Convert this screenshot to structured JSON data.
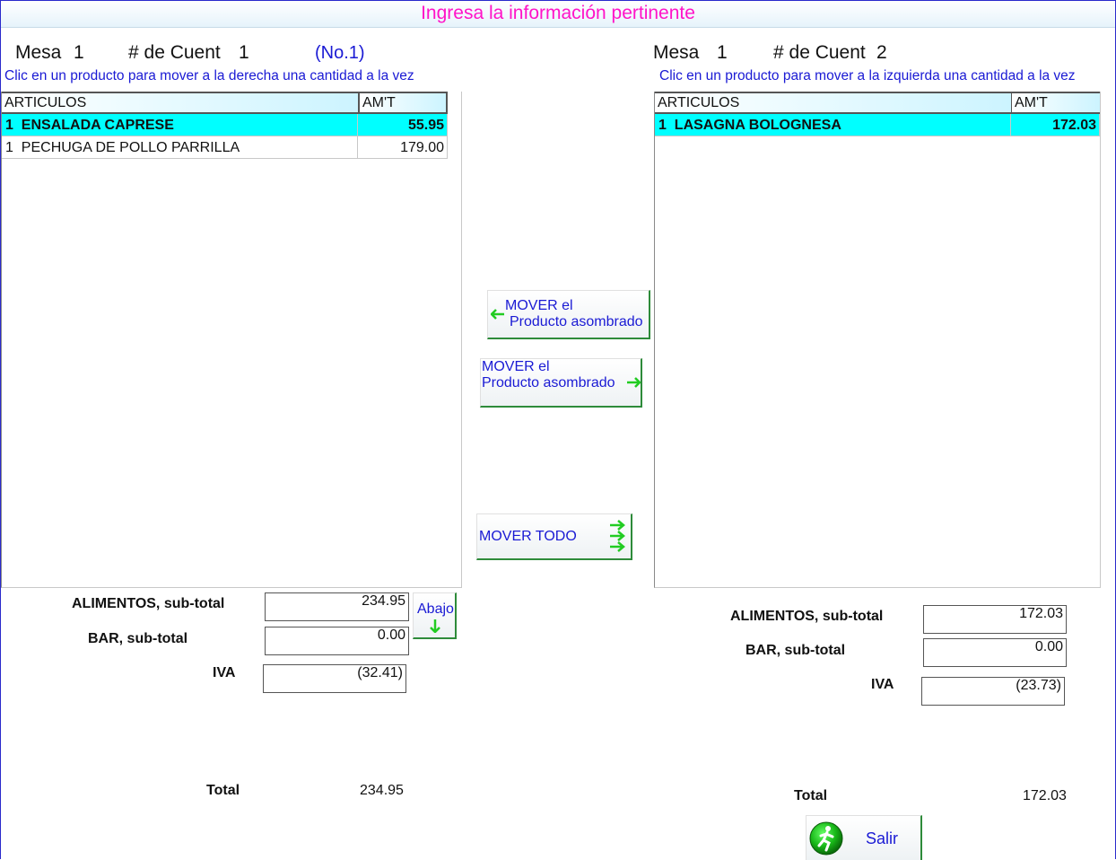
{
  "title": "Ingresa la información pertinente",
  "left": {
    "mesa_label": "Mesa",
    "mesa_value": "1",
    "cuenta_label": "# de Cuent",
    "cuenta_value": "1",
    "cuenta_no": "(No.1)",
    "hint": "Clic en un producto para mover a la derecha una cantidad a la vez",
    "columns": [
      "ARTICULOS",
      "AM'T"
    ],
    "rows": [
      {
        "qty": "1",
        "name": "ENSALADA CAPRESE",
        "amount": "55.95",
        "selected": true
      },
      {
        "qty": "1",
        "name": "PECHUGA DE POLLO PARRILLA",
        "amount": "179.00",
        "selected": false
      }
    ],
    "alimentos_label": "ALIMENTOS, sub-total",
    "alimentos_value": "234.95",
    "bar_label": "BAR, sub-total",
    "bar_value": "0.00",
    "iva_label": "IVA",
    "iva_value": "(32.41)",
    "total_label": "Total",
    "total_value": "234.95",
    "abajo_label": "Abajo"
  },
  "right": {
    "mesa_label": "Mesa",
    "mesa_value": "1",
    "cuenta_label": "# de Cuent",
    "cuenta_value": "2",
    "hint": "Clic en un producto para mover a la izquierda una cantidad a la vez",
    "columns": [
      "ARTICULOS",
      "AM'T"
    ],
    "rows": [
      {
        "qty": "1",
        "name": "LASAGNA BOLOGNESA",
        "amount": "172.03",
        "selected": true
      }
    ],
    "alimentos_label": "ALIMENTOS, sub-total",
    "alimentos_value": "172.03",
    "bar_label": "BAR, sub-total",
    "bar_value": "0.00",
    "iva_label": "IVA",
    "iva_value": "(23.73)",
    "total_label": "Total",
    "total_value": "172.03"
  },
  "buttons": {
    "move_left_line1": "MOVER el",
    "move_left_line2": "Producto asombrado",
    "move_right_line1": "MOVER el",
    "move_right_line2": "Producto asombrado",
    "move_all": "MOVER TODO",
    "salir": "Salir"
  },
  "colors": {
    "title": "#ff14c8",
    "link_blue": "#1a1ad4",
    "selected_row": "#00ffff",
    "button_border": "#2e8b3a",
    "arrow_green": "#22cc22"
  },
  "icons": [
    "arrow-left-icon",
    "arrow-right-icon",
    "triple-arrow-right-icon",
    "arrow-down-icon",
    "runner-icon"
  ]
}
